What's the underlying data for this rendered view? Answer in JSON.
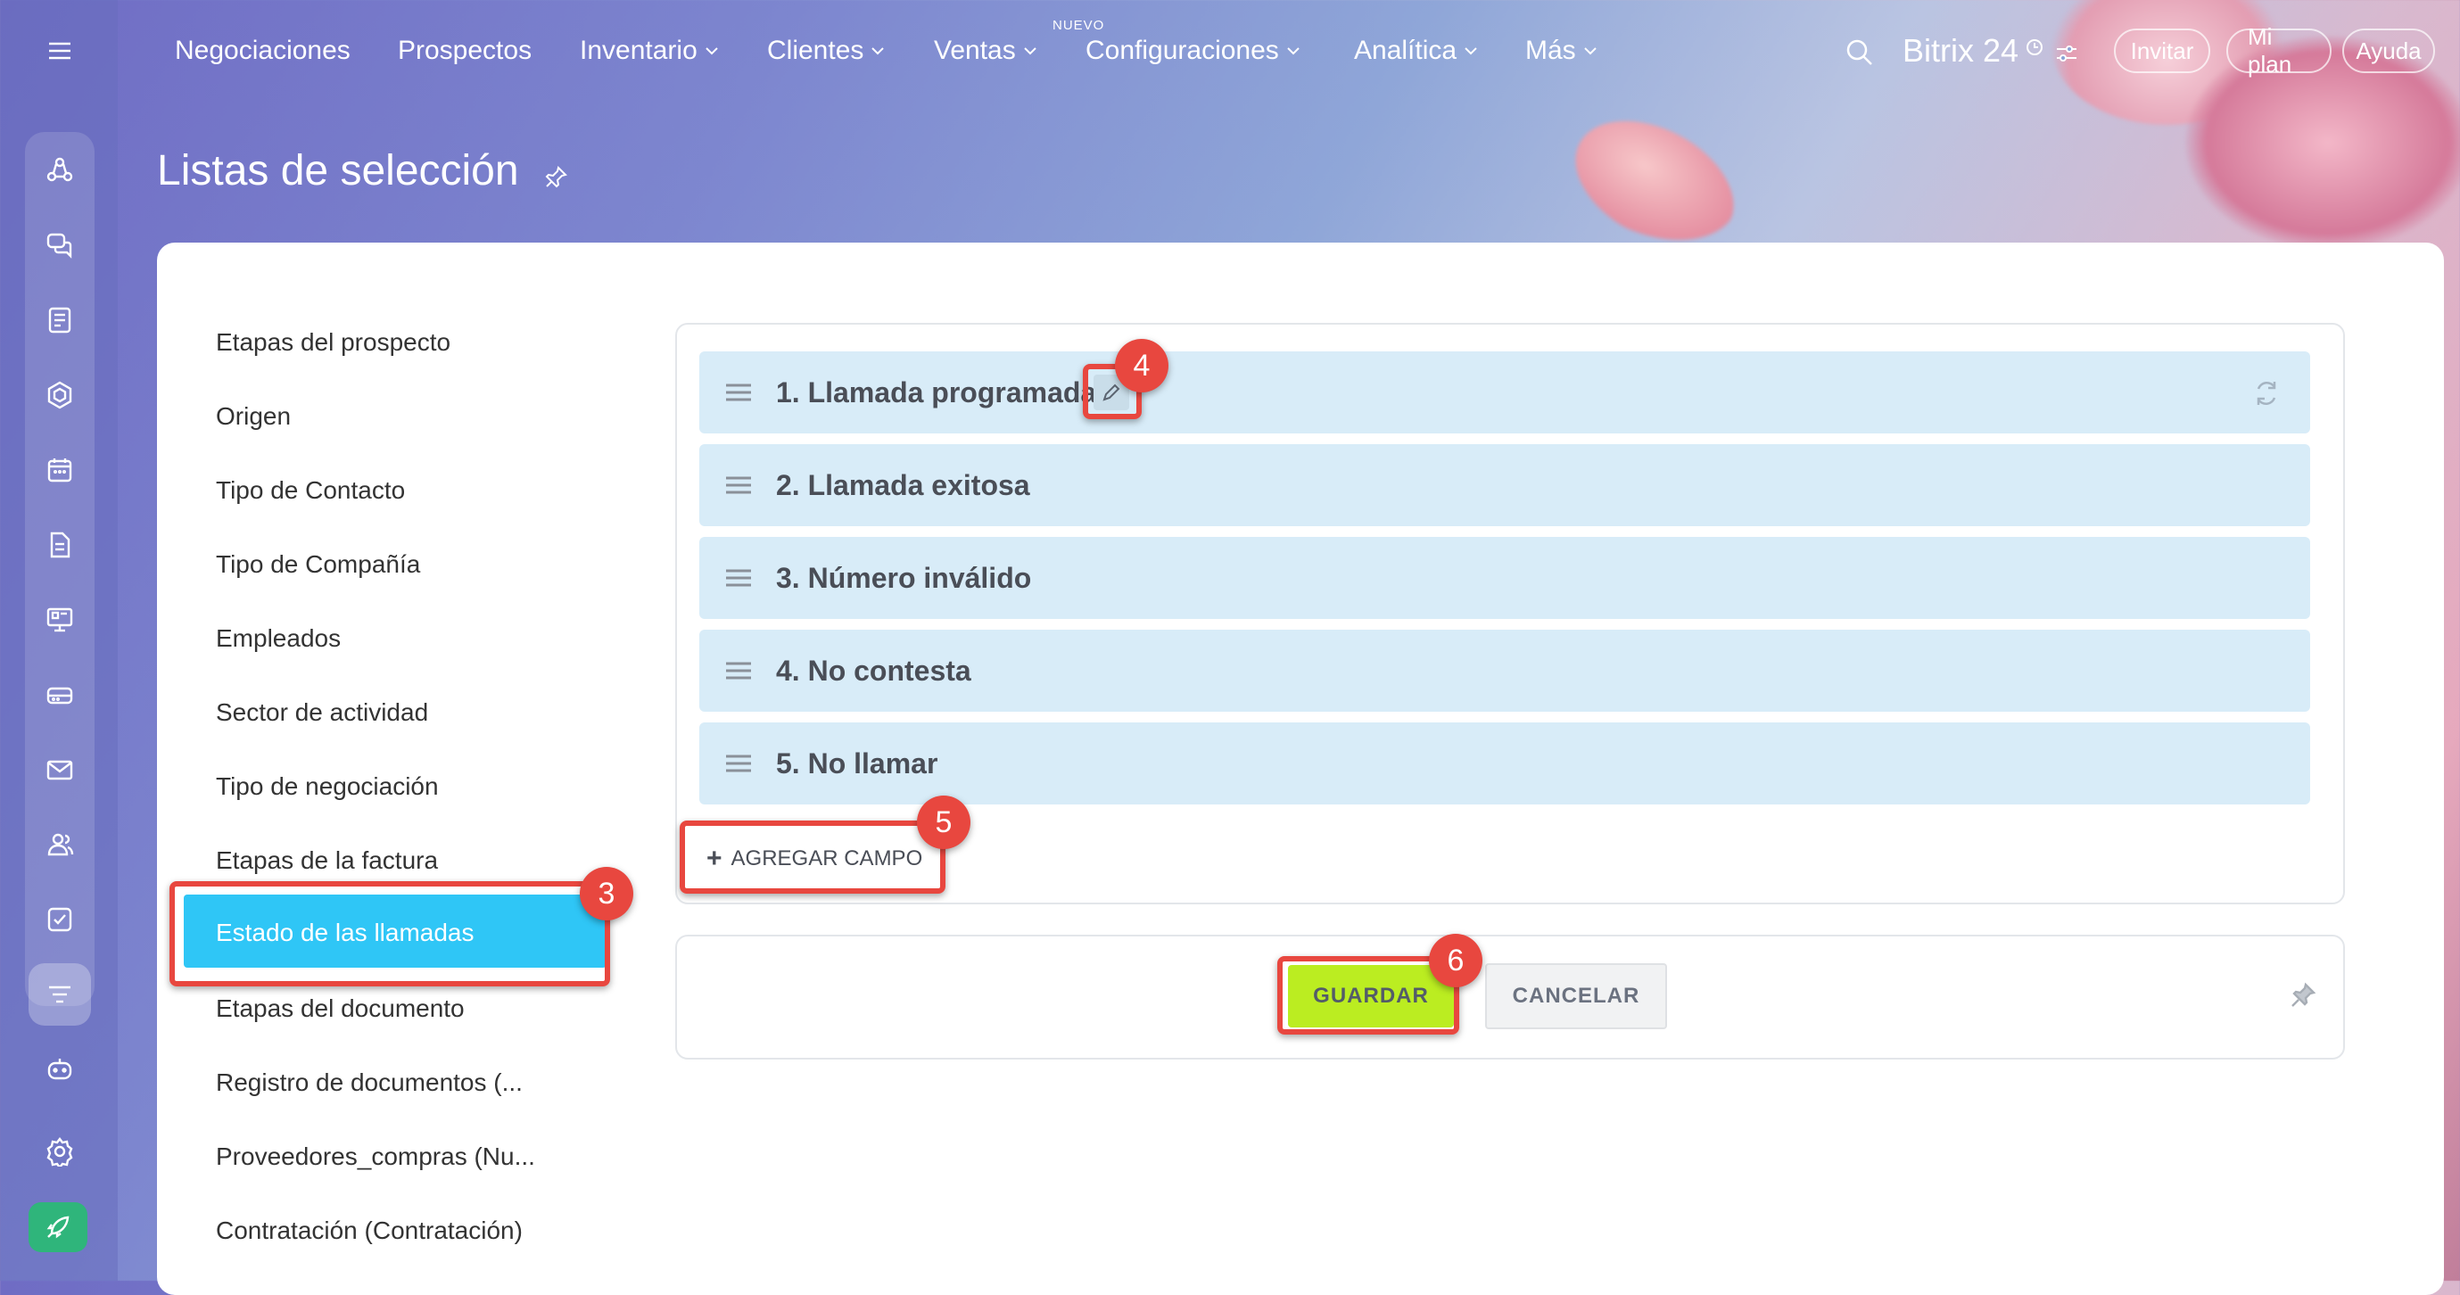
{
  "header": {
    "nav": [
      {
        "label": "Negociaciones",
        "has_dropdown": false
      },
      {
        "label": "Prospectos",
        "has_dropdown": false
      },
      {
        "label": "Inventario",
        "has_dropdown": true
      },
      {
        "label": "Clientes",
        "has_dropdown": true
      },
      {
        "label": "Ventas",
        "has_dropdown": true,
        "tag": "NUEVO"
      },
      {
        "label": "Configuraciones",
        "has_dropdown": true
      },
      {
        "label": "Analítica",
        "has_dropdown": true
      },
      {
        "label": "Más",
        "has_dropdown": true
      }
    ],
    "brand": "Bitrix 24",
    "invite_label": "Invitar",
    "plan_label": "Mi plan",
    "help_label": "Ayuda"
  },
  "page": {
    "title": "Listas de selección"
  },
  "sidebar": {
    "items": [
      "Etapas del prospecto",
      "Origen",
      "Tipo de Contacto",
      "Tipo de Compañía",
      "Empleados",
      "Sector de actividad",
      "Tipo de negociación",
      "Etapas de la factura",
      "Estado de las llamadas",
      "Etapas del documento",
      "Registro de documentos (...",
      "Proveedores_compras (Nu...",
      "Contratación (Contratación)"
    ],
    "active_index": 8
  },
  "list": {
    "items": [
      "1. Llamada programada",
      "2. Llamada exitosa",
      "3. Número inválido",
      "4. No contesta",
      "5. No llamar"
    ],
    "add_label": "AGREGAR CAMPO"
  },
  "footer": {
    "save_label": "GUARDAR",
    "cancel_label": "CANCELAR"
  },
  "annotations": [
    "3",
    "4",
    "5",
    "6"
  ],
  "colors": {
    "accent": "#2fc6f6",
    "save": "#bbed21",
    "highlight": "#e8473f",
    "row": "#d8ecf8"
  },
  "icons": {
    "rail": [
      "menu-icon",
      "crm-icon",
      "chat-icon",
      "feed-icon",
      "collab-icon",
      "calendar-icon",
      "docs-icon",
      "sites-icon",
      "store-icon",
      "mail-icon",
      "contacts-icon",
      "tasks-icon",
      "funnel-icon",
      "bot-icon",
      "settings-icon",
      "rocket-icon"
    ]
  }
}
